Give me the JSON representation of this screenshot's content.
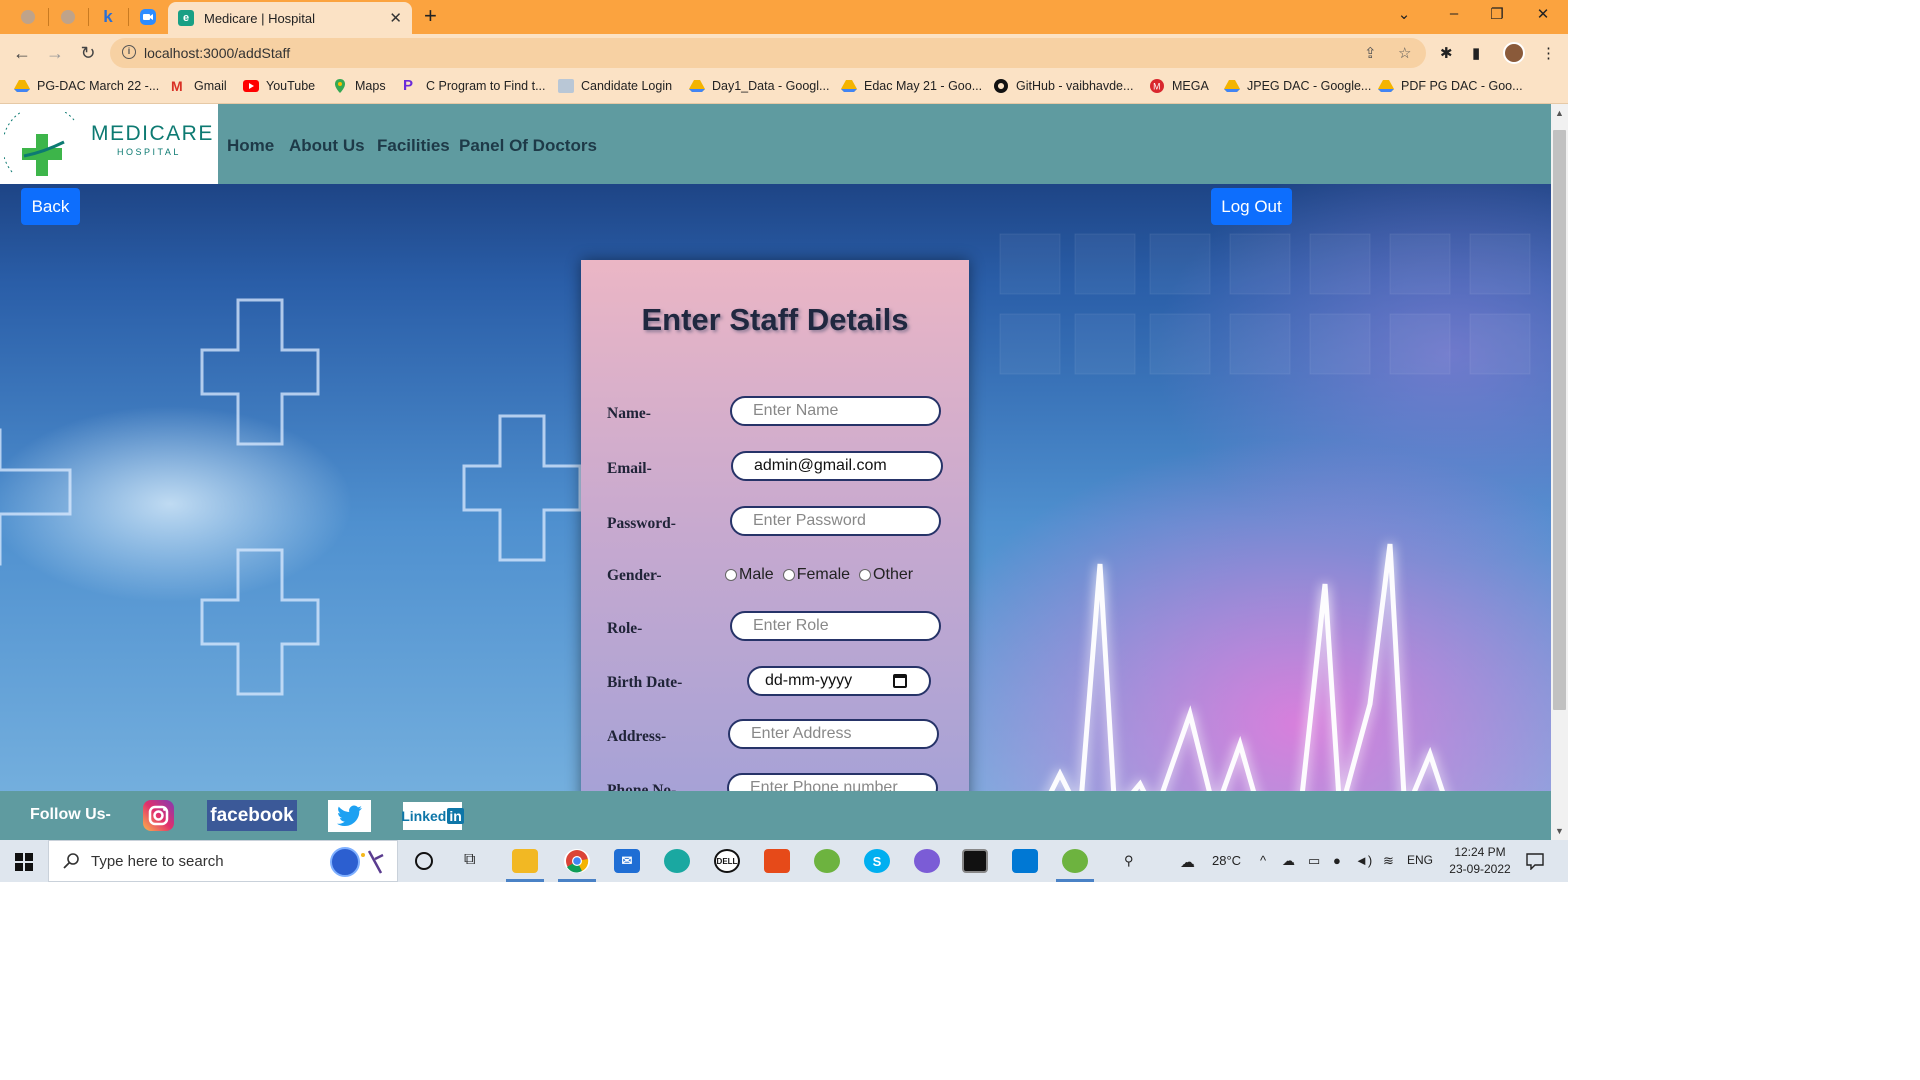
{
  "browser": {
    "active_tab_title": "Medicare | Hospital",
    "url": "localhost:3000/addStaff",
    "bookmarks": [
      "PG-DAC March 22 -...",
      "Gmail",
      "YouTube",
      "Maps",
      "C Program to Find t...",
      "Candidate Login",
      "Day1_Data - Googl...",
      "Edac May 21 - Goo...",
      "GitHub - vaibhavde...",
      "MEGA",
      "JPEG DAC - Google...",
      "PDF PG DAC - Goo..."
    ]
  },
  "site": {
    "logo": {
      "name": "MEDICARE",
      "sub": "HOSPITAL",
      "arc_text": "HEALING HANDS CARING HEARTS"
    },
    "nav": [
      "Home",
      "About Us",
      "Facilities",
      "Panel Of Doctors"
    ],
    "back_label": "Back",
    "logout_label": "Log Out"
  },
  "form": {
    "title": "Enter Staff Details",
    "fields": {
      "name": {
        "label": "Name-",
        "placeholder": "Enter Name"
      },
      "email": {
        "label": "Email-",
        "value": "admin@gmail.com"
      },
      "password": {
        "label": "Password-",
        "placeholder": "Enter Password"
      },
      "gender": {
        "label": "Gender-",
        "options": [
          "Male",
          "Female",
          "Other"
        ]
      },
      "role": {
        "label": "Role-",
        "placeholder": "Enter Role"
      },
      "birth_date": {
        "label": "Birth Date-",
        "placeholder": "dd-mm-yyyy"
      },
      "address": {
        "label": "Address-",
        "placeholder": "Enter Address"
      },
      "phone": {
        "label": "Phone No-",
        "placeholder": "Enter Phone number"
      }
    }
  },
  "footer": {
    "follow_label": "Follow Us-",
    "facebook": "facebook",
    "linkedin": "Linked",
    "linkedin_in": "in"
  },
  "taskbar": {
    "search_placeholder": "Type here to search",
    "weather": "28°C",
    "language": "ENG",
    "time": "12:24 PM",
    "date": "23-09-2022"
  },
  "colors": {
    "tabstrip": "#fba33f",
    "toolbar": "#fbe2c5",
    "site_nav": "#5f9ba0",
    "primary_button": "#0d6efd",
    "logo_teal": "#0d7a72"
  }
}
